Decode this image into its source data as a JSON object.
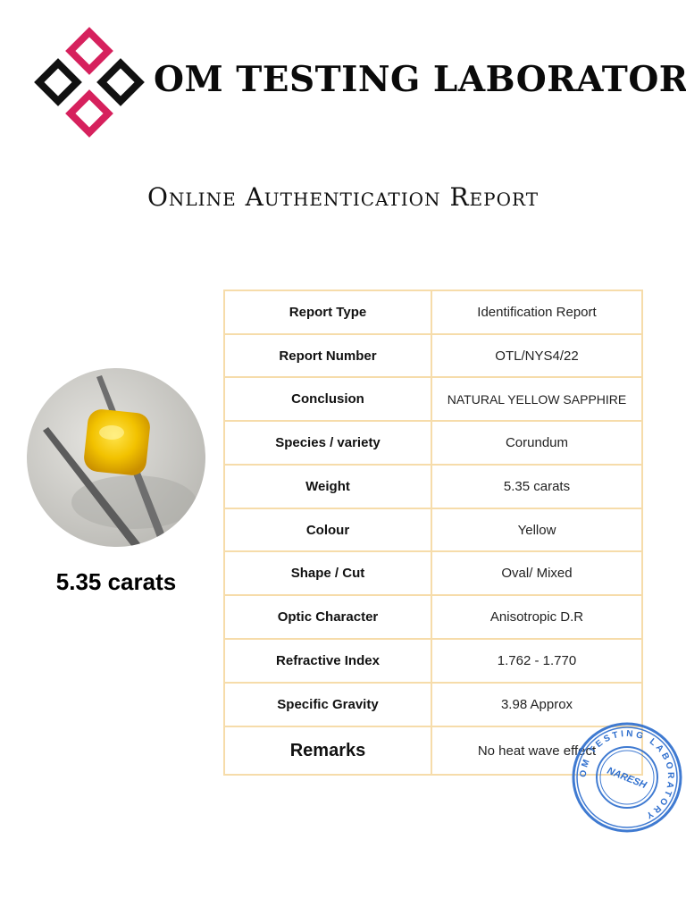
{
  "header": {
    "lab_name": "OM TESTING LABORATORY",
    "report_title": "Online Authentication Report",
    "logo_colors": {
      "pink": "#d6215d",
      "black": "#111111"
    }
  },
  "gem": {
    "photo": "yellow-sapphire-in-tweezers",
    "weight_caption": "5.35 carats"
  },
  "report": {
    "rows": [
      {
        "label": "Report Type",
        "value": "Identification Report"
      },
      {
        "label": "Report Number",
        "value": "OTL/NYS4/22"
      },
      {
        "label": "Conclusion",
        "value": "NATURAL YELLOW SAPPHIRE"
      },
      {
        "label": "Species / variety",
        "value": "Corundum"
      },
      {
        "label": "Weight",
        "value": "5.35 carats"
      },
      {
        "label": "Colour",
        "value": "Yellow"
      },
      {
        "label": "Shape / Cut",
        "value": "Oval/ Mixed"
      },
      {
        "label": "Optic Character",
        "value": "Anisotropic D.R"
      },
      {
        "label": "Refractive Index",
        "value": "1.762 - 1.770"
      },
      {
        "label": "Specific Gravity",
        "value": "3.98 Approx"
      },
      {
        "label": "Remarks",
        "value": "No heat wave effect"
      }
    ],
    "border_color": "#f6dcaa"
  },
  "stamp": {
    "ring_text": "OM TESTING LABORATORY",
    "signature": "NARESH",
    "color": "#2f6fce"
  }
}
